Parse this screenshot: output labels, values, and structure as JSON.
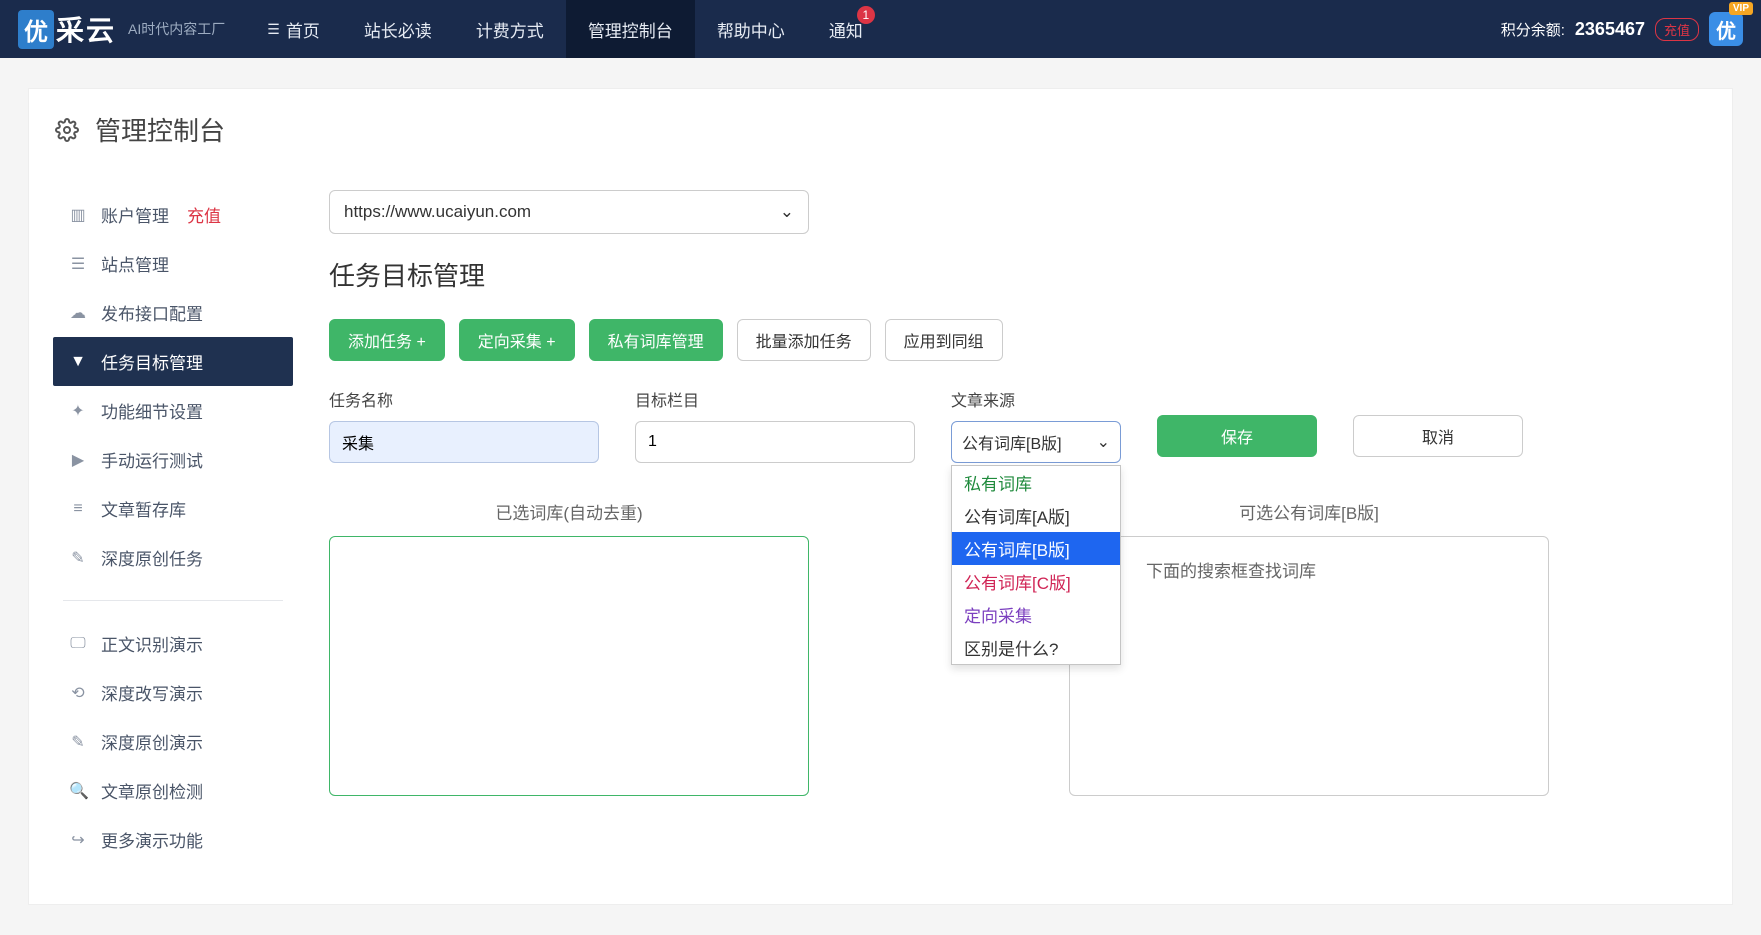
{
  "topnav": {
    "logo_square": "优",
    "logo_text": "采云",
    "logo_sub": "AI时代内容工厂",
    "items": [
      {
        "label": "首页"
      },
      {
        "label": "站长必读"
      },
      {
        "label": "计费方式"
      },
      {
        "label": "管理控制台"
      },
      {
        "label": "帮助中心"
      },
      {
        "label": "通知",
        "badge": "1"
      }
    ],
    "balance_label": "积分余额:",
    "balance_value": "2365467",
    "recharge": "充值",
    "avatar": "优",
    "vip": "VIP"
  },
  "page_title": "管理控制台",
  "sidebar": {
    "groups": [
      [
        {
          "icon": "chart",
          "label": "账户管理",
          "extra": "充值"
        },
        {
          "icon": "list",
          "label": "站点管理"
        },
        {
          "icon": "cloud",
          "label": "发布接口配置"
        },
        {
          "icon": "filter",
          "label": "任务目标管理",
          "active": true
        },
        {
          "icon": "sliders",
          "label": "功能细节设置"
        },
        {
          "icon": "play",
          "label": "手动运行测试"
        },
        {
          "icon": "db",
          "label": "文章暂存库"
        },
        {
          "icon": "edit",
          "label": "深度原创任务"
        }
      ],
      [
        {
          "icon": "monitor",
          "label": "正文识别演示"
        },
        {
          "icon": "refresh",
          "label": "深度改写演示"
        },
        {
          "icon": "edit",
          "label": "深度原创演示"
        },
        {
          "icon": "search",
          "label": "文章原创检测"
        },
        {
          "icon": "share",
          "label": "更多演示功能"
        }
      ]
    ]
  },
  "main": {
    "url_select": "https://www.ucaiyun.com",
    "section_title": "任务目标管理",
    "buttons": {
      "add_task": "添加任务 +",
      "directed": "定向采集 +",
      "private_lib": "私有词库管理",
      "batch_add": "批量添加任务",
      "apply_group": "应用到同组"
    },
    "form": {
      "task_label": "任务名称",
      "task_value": "采集",
      "column_label": "目标栏目",
      "column_value": "1",
      "source_label": "文章来源",
      "source_value": "公有词库[B版]",
      "save": "保存",
      "cancel": "取消",
      "dropdown": [
        {
          "label": "私有词库",
          "cls": "green"
        },
        {
          "label": "公有词库[A版]",
          "cls": ""
        },
        {
          "label": "公有词库[B版]",
          "cls": "selected"
        },
        {
          "label": "公有词库[C版]",
          "cls": "red"
        },
        {
          "label": "定向采集",
          "cls": "purple"
        },
        {
          "label": "区别是什么?",
          "cls": ""
        }
      ]
    },
    "libs": {
      "left_title": "已选词库(自动去重)",
      "right_title": "可选公有词库[B版]",
      "right_hint": "下面的搜索框查找词库"
    }
  }
}
